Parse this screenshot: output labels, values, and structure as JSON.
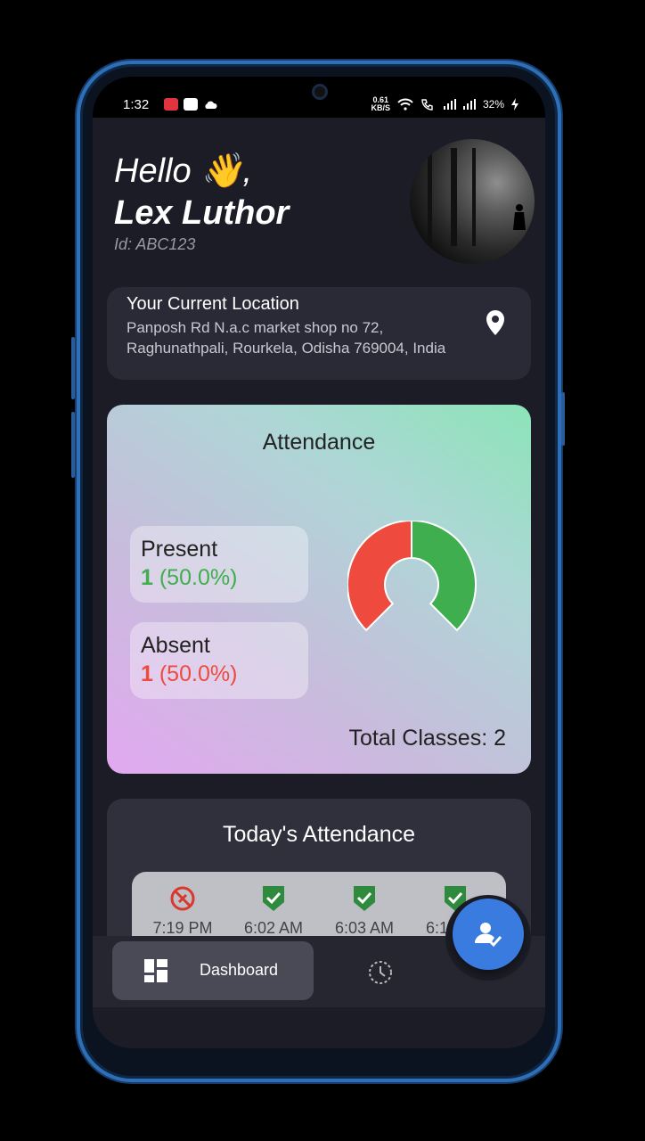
{
  "status_bar": {
    "time": "1:32",
    "net_speed_value": "0.61",
    "net_speed_unit": "KB/S",
    "battery": "32%"
  },
  "header": {
    "greeting": "Hello 👋,",
    "user_name": "Lex Luthor",
    "user_id": "Id: ABC123"
  },
  "location": {
    "title": "Your Current Location",
    "address": "Panposh Rd N.a.c market shop no 72, Raghunathpali, Rourkela, Odisha 769004, India",
    "icon": "location-pin-icon"
  },
  "attendance": {
    "title": "Attendance",
    "present_label": "Present",
    "present_count": "1",
    "present_percent": "(50.0%)",
    "absent_label": "Absent",
    "absent_count": "1",
    "absent_percent": "(50.0%)",
    "total_label": "Total Classes: 2",
    "colors": {
      "present": "#3fae4f",
      "absent": "#ee4b3e"
    },
    "gauge": {
      "present_fraction": 0.5,
      "absent_fraction": 0.5
    }
  },
  "today": {
    "title": "Today's Attendance",
    "records": [
      {
        "time": "7:19 PM",
        "status": "absent",
        "icon": "absent-x-icon"
      },
      {
        "time": "6:02 AM",
        "status": "present",
        "icon": "verified-shield-icon"
      },
      {
        "time": "6:03 AM",
        "status": "present",
        "icon": "verified-shield-icon"
      },
      {
        "time": "6:12 AM",
        "status": "present",
        "icon": "verified-shield-icon"
      }
    ]
  },
  "nav": {
    "dashboard_label": "Dashboard",
    "dashboard_icon": "dashboard-grid-icon",
    "history_icon": "history-clock-icon",
    "fab_icon": "mark-attendance-icon"
  }
}
